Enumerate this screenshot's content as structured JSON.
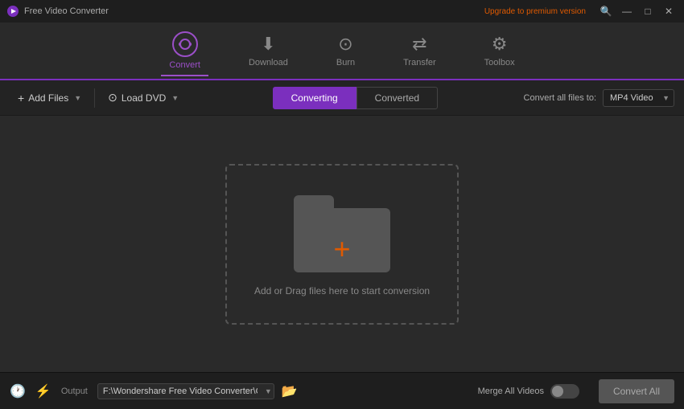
{
  "titleBar": {
    "appTitle": "Free Video Converter",
    "upgradeLabel": "Upgrade to premium version",
    "searchIcon": "🔍",
    "minimizeIcon": "—",
    "maximizeIcon": "□",
    "closeIcon": "✕"
  },
  "nav": {
    "items": [
      {
        "id": "convert",
        "label": "Convert",
        "active": true
      },
      {
        "id": "download",
        "label": "Download",
        "active": false
      },
      {
        "id": "burn",
        "label": "Burn",
        "active": false
      },
      {
        "id": "transfer",
        "label": "Transfer",
        "active": false
      },
      {
        "id": "toolbox",
        "label": "Toolbox",
        "active": false
      }
    ]
  },
  "toolbar": {
    "addFilesLabel": "Add Files",
    "loadDvdLabel": "Load DVD"
  },
  "tabs": {
    "converting": "Converting",
    "converted": "Converted",
    "activeTab": "converting"
  },
  "convertAllArea": {
    "label": "Convert all files to:",
    "format": "MP4 Video"
  },
  "dropZone": {
    "label": "Add or Drag files here to start conversion"
  },
  "statusBar": {
    "outputLabel": "Output",
    "outputPath": "F:\\Wondershare Free Video Converter\\Converted",
    "mergeLabel": "Merge All Videos",
    "convertAllBtn": "Convert All"
  }
}
